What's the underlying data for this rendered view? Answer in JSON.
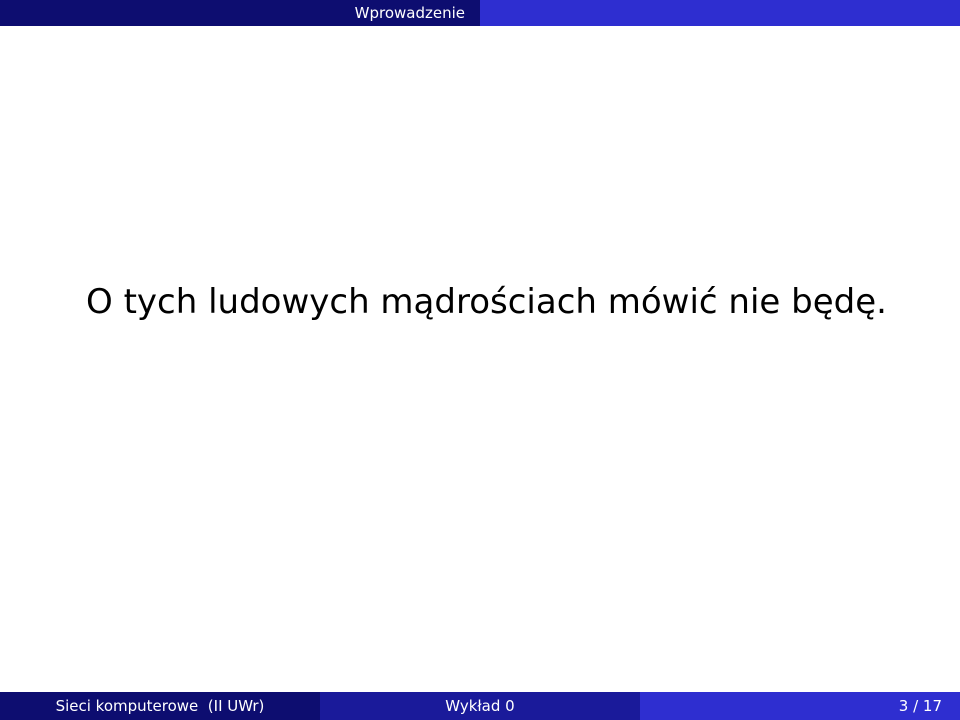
{
  "header": {
    "section": "Wprowadzenie"
  },
  "content": {
    "text": "O tych ludowych mądrościach mówić nie będę."
  },
  "footer": {
    "author": "Sieci komputerowe  (II UWr)",
    "title": "Wykład 0",
    "page_current": "3",
    "page_separator": "/",
    "page_total": "17"
  },
  "colors": {
    "header_dark": "#0d0d70",
    "header_light": "#2e2ed0",
    "footer_left": "#0d0d70",
    "footer_mid": "#1a1a9a",
    "footer_right": "#2e2ed0",
    "text": "#000000"
  }
}
